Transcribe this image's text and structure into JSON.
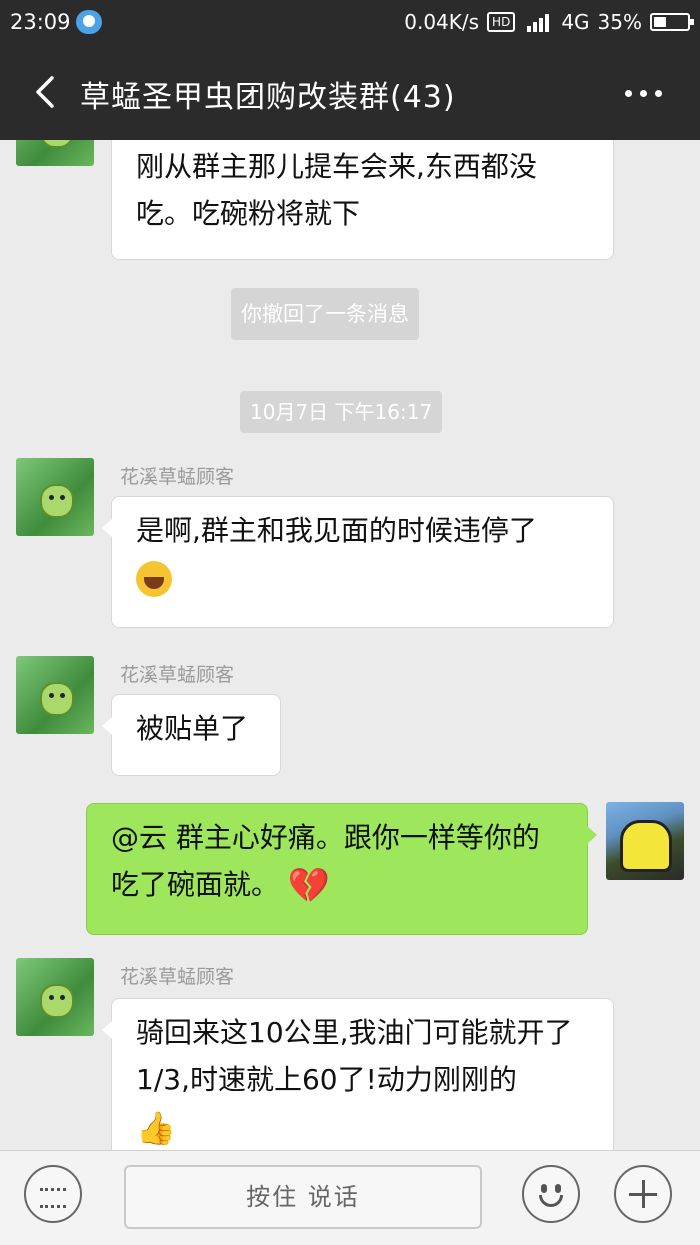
{
  "status_bar": {
    "time": "23:09",
    "net_speed": "0.04K/s",
    "hd": "HD",
    "network": "4G",
    "battery": "35%"
  },
  "header": {
    "title": "草蜢圣甲虫团购改装群(43)"
  },
  "messages": {
    "m1_text": "刚从群主那儿提车会来,东西都没吃。吃碗粉将就下",
    "sys_recall": "你撤回了一条消息",
    "time_stamp": "10月7日 下午16:17",
    "m2_sender": "花溪草蜢顾客",
    "m2_text": "是啊,群主和我见面的时候违停了",
    "m3_sender": "花溪草蜢顾客",
    "m3_text": "被贴单了",
    "m4_text": "@云 群主心好痛。跟你一样等你的吃了碗面就。",
    "m5_sender": "花溪草蜢顾客",
    "m5_text": "骑回来这10公里,我油门可能就开了1/3,时速就上60了!动力刚刚的"
  },
  "input_bar": {
    "hold_to_talk": "按住 说话"
  },
  "icons": {
    "back": "chevron-left-icon",
    "more": "more-dots-icon",
    "keyboard": "keyboard-icon",
    "emoji": "smile-icon",
    "plus": "plus-icon"
  },
  "colors": {
    "header_bg": "#2b2b2b",
    "chat_bg": "#ebebeb",
    "self_bubble": "#9ee65b",
    "other_bubble": "#ffffff"
  }
}
